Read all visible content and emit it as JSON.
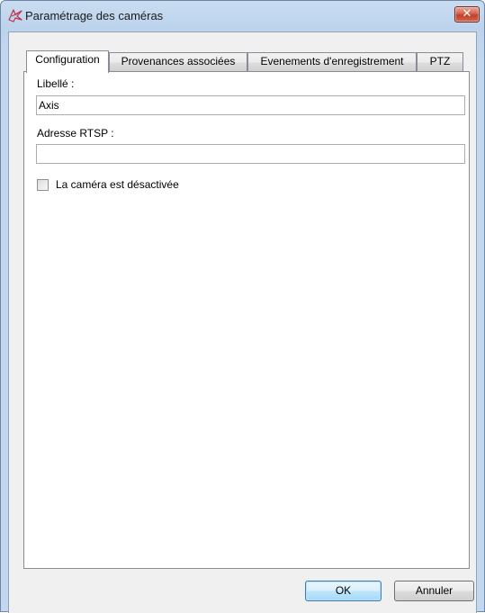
{
  "window": {
    "title": "Paramétrage des caméras",
    "close_label": "✕"
  },
  "tabs": [
    {
      "label": "Configuration",
      "active": true
    },
    {
      "label": "Provenances associées",
      "active": false
    },
    {
      "label": "Evenements d'enregistrement",
      "active": false
    },
    {
      "label": "PTZ",
      "active": false
    }
  ],
  "form": {
    "libelle_label": "Libellé :",
    "libelle_value": "Axis",
    "rtsp_label": "Adresse RTSP :",
    "rtsp_value": "",
    "disabled_checkbox_label": "La caméra est désactivée",
    "disabled_checked": false
  },
  "buttons": {
    "ok": "OK",
    "cancel": "Annuler"
  },
  "icons": {
    "title": "camera-icon",
    "close": "close-icon",
    "checkbox": "checkbox-icon"
  },
  "colors": {
    "title_bar": "#c9ddf1",
    "close_button": "#c0402a",
    "dialog_background": "#f0f0f0",
    "default_button_border": "#3c7fb1"
  }
}
